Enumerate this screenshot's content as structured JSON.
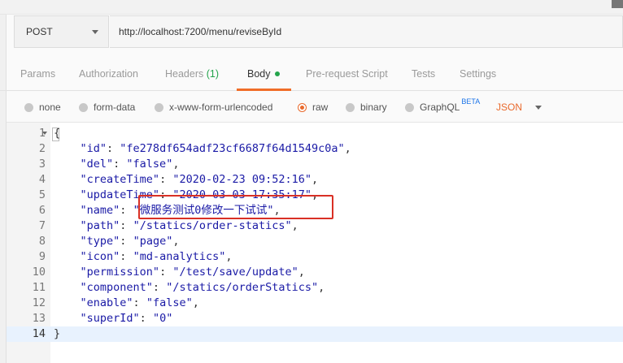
{
  "request": {
    "method": "POST",
    "url": "http://localhost:7200/menu/reviseById"
  },
  "tabs": [
    {
      "label": "Params"
    },
    {
      "label": "Authorization"
    },
    {
      "label": "Headers",
      "count": "(1)"
    },
    {
      "label": "Body",
      "active": true
    },
    {
      "label": "Pre-request Script"
    },
    {
      "label": "Tests"
    },
    {
      "label": "Settings"
    }
  ],
  "body_options": {
    "none": "none",
    "form_data": "form-data",
    "urlencoded": "x-www-form-urlencoded",
    "raw": "raw",
    "binary": "binary",
    "graphql": "GraphQL",
    "beta": "BETA",
    "format": "JSON",
    "selected": "raw"
  },
  "editor": {
    "lines": [
      {
        "n": "1",
        "key": "",
        "value": "",
        "text": "{"
      },
      {
        "n": "2",
        "key": "\"id\"",
        "value": "\"fe278df654adf23cf6687f64d1549c0a\""
      },
      {
        "n": "3",
        "key": "\"del\"",
        "value": "\"false\""
      },
      {
        "n": "4",
        "key": "\"createTime\"",
        "value": "\"2020-02-23 09:52:16\""
      },
      {
        "n": "5",
        "key": "\"updateTime\"",
        "value": "\"2020-03-03 17:35:17\""
      },
      {
        "n": "6",
        "key": "\"name\"",
        "value": "\"微服务测试0修改一下试试\""
      },
      {
        "n": "7",
        "key": "\"path\"",
        "value": "\"/statics/order-statics\""
      },
      {
        "n": "8",
        "key": "\"type\"",
        "value": "\"page\""
      },
      {
        "n": "9",
        "key": "\"icon\"",
        "value": "\"md-analytics\""
      },
      {
        "n": "10",
        "key": "\"permission\"",
        "value": "\"/test/save/update\""
      },
      {
        "n": "11",
        "key": "\"component\"",
        "value": "\"/statics/orderStatics\""
      },
      {
        "n": "12",
        "key": "\"enable\"",
        "value": "\"false\""
      },
      {
        "n": "13",
        "key": "\"superId\"",
        "value": "\"0\""
      },
      {
        "n": "14",
        "key": "",
        "value": "",
        "text": "}"
      }
    ]
  },
  "colors": {
    "accent": "#f06d28",
    "highlight_box": "#d93025",
    "json_token": "#1a1aa6",
    "badge_green": "#24a44c"
  }
}
